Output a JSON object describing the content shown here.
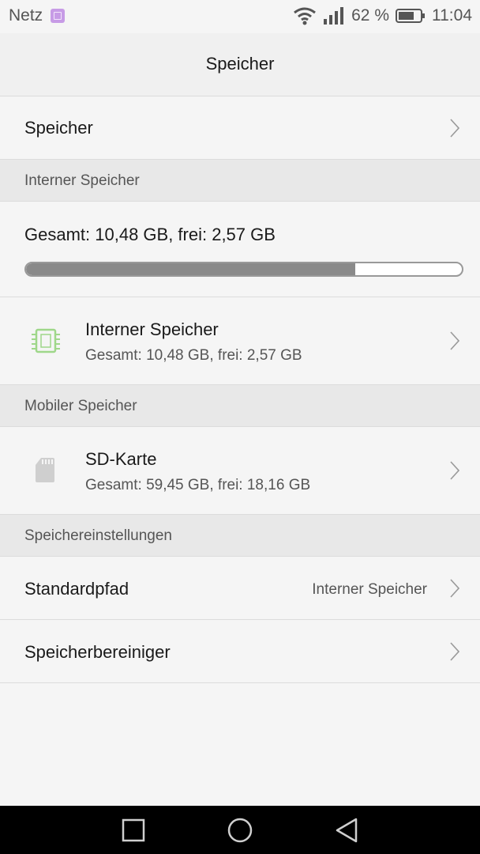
{
  "status_bar": {
    "carrier": "Netz",
    "battery_percent": "62 %",
    "time": "11:04",
    "icons": [
      "gallery-icon",
      "wifi-icon",
      "signal-icon",
      "battery-icon"
    ]
  },
  "header": {
    "title": "Speicher"
  },
  "storage_row": {
    "label": "Speicher"
  },
  "internal_section": {
    "header": "Interner Speicher",
    "summary": "Gesamt: 10,48 GB, frei: 2,57 GB",
    "used_fraction": 0.755,
    "item": {
      "icon": "chip-icon",
      "title": "Interner Speicher",
      "subtitle": "Gesamt: 10,48 GB, frei: 2,57 GB"
    }
  },
  "mobile_section": {
    "header": "Mobiler Speicher",
    "item": {
      "icon": "sd-card-icon",
      "title": "SD-Karte",
      "subtitle": "Gesamt: 59,45 GB, frei: 18,16 GB"
    }
  },
  "settings_section": {
    "header": "Speichereinstellungen",
    "default_path": {
      "label": "Standardpfad",
      "value": "Interner Speicher"
    },
    "cleaner": {
      "label": "Speicherbereiniger"
    }
  },
  "nav_bar": {
    "icons": [
      "recent-apps-icon",
      "home-icon",
      "back-icon"
    ]
  },
  "colors": {
    "chip_icon": "#9fd78a",
    "sd_icon": "#cfcfcf",
    "progress_fill": "#8a8a8a",
    "section_header_bg": "#e8e8e8"
  }
}
